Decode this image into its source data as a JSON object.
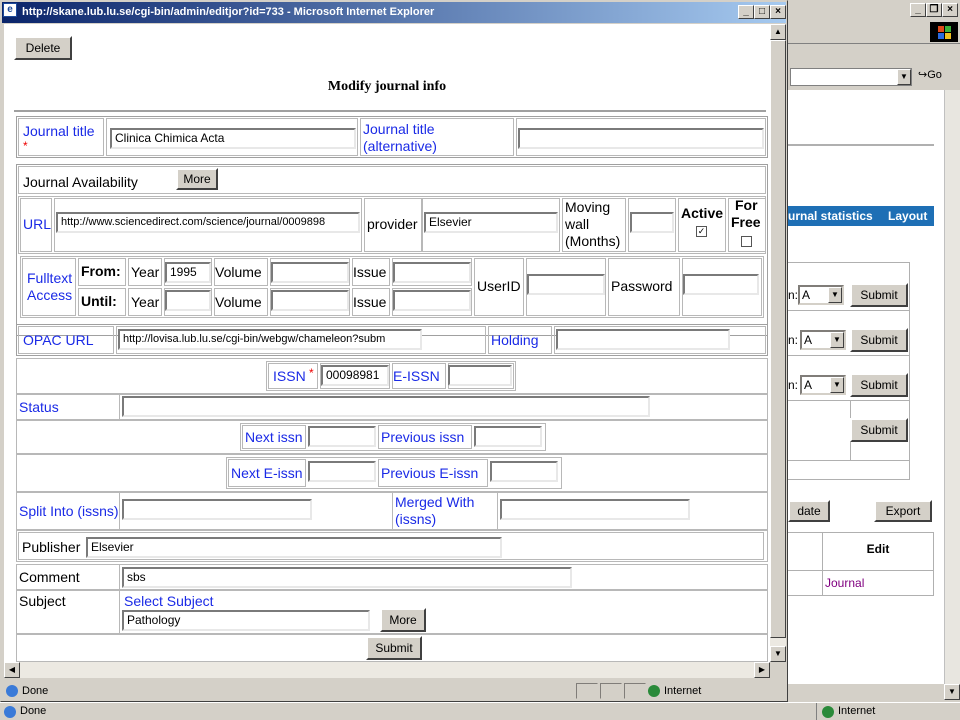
{
  "popup": {
    "title": "http://skane.lub.lu.se/cgi-bin/admin/editjor?id=733 - Microsoft Internet Explorer",
    "status_done": "Done",
    "status_zone": "Internet"
  },
  "form": {
    "delete_label": "Delete",
    "heading": "Modify journal info",
    "journal_title_label": "Journal title",
    "required_mark": "*",
    "journal_title_value": "Clinica Chimica Acta",
    "journal_title_alt_label_1": "Journal title",
    "journal_title_alt_label_2": "(alternative)",
    "journal_title_alt_value": "",
    "availability_label": "Journal Availability",
    "more_label": "More",
    "url_label": "URL",
    "url_value": "http://www.sciencedirect.com/science/journal/0009898",
    "provider_label": "provider",
    "provider_value": "Elsevier",
    "moving_wall_1": "Moving",
    "moving_wall_2": "wall",
    "moving_wall_3": "(Months)",
    "moving_wall_value": "",
    "active_label": "Active",
    "active_check": "✓",
    "for_free_1": "For",
    "for_free_2": "Free",
    "fulltext_label_1": "Fulltext",
    "fulltext_label_2": "Access",
    "from_label": "From:",
    "until_label": "Until:",
    "year_label": "Year",
    "from_year_value": "1995",
    "until_year_value": "",
    "volume_label": "Volume",
    "issue_label": "Issue",
    "userid_label": "UserID",
    "password_label": "Password",
    "opac_label": "OPAC URL",
    "opac_value": "http://lovisa.lub.lu.se/cgi-bin/webgw/chameleon?subm",
    "holding_label": "Holding",
    "holding_value": "",
    "issn_label": "ISSN",
    "issn_value": "00098981",
    "eissn_label": "E-ISSN",
    "eissn_value": "",
    "status_label": "Status",
    "status_value": "",
    "next_issn_label": "Next issn",
    "prev_issn_label": "Previous issn",
    "next_eissn_label": "Next E-issn",
    "prev_eissn_label": "Previous E-issn",
    "split_label": "Split Into (issns)",
    "merged_label_1": "Merged With",
    "merged_label_2": "(issns)",
    "publisher_label": "Publisher",
    "publisher_value": "Elsevier",
    "comment_label": "Comment",
    "comment_value": "sbs",
    "subject_label": "Subject",
    "select_subject_label": "Select Subject",
    "subject_value": "Pathology",
    "subject_more_label": "More",
    "submit_label": "Submit"
  },
  "background": {
    "nav_items": [
      "urnal statistics",
      "Layout"
    ],
    "go_label": "Go",
    "select_value": "A",
    "select_prefix": "n:",
    "submit_label": "Submit",
    "update_label": "date",
    "export_label": "Export",
    "edit_header": "Edit",
    "journal_link": "Journal",
    "status_done": "Done",
    "status_zone": "Internet"
  },
  "colors": {
    "link_blue": "#1a2ae6",
    "nav_bar": "#1e6fb5",
    "required_red": "#e00000",
    "visited_link": "#800080"
  }
}
